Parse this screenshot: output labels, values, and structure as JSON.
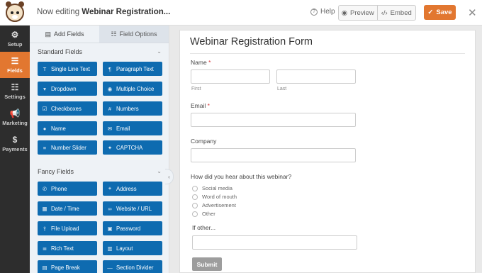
{
  "topbar": {
    "title_prefix": "Now editing ",
    "title_form": "Webinar Registration...",
    "help_label": "Help",
    "preview_label": "Preview",
    "embed_label": "Embed",
    "save_label": "Save",
    "close_glyph": "✕"
  },
  "leftnav": [
    {
      "label": "Setup",
      "icon": "gear-icon"
    },
    {
      "label": "Fields",
      "icon": "list-icon"
    },
    {
      "label": "Settings",
      "icon": "sliders-icon"
    },
    {
      "label": "Marketing",
      "icon": "megaphone-icon"
    },
    {
      "label": "Payments",
      "icon": "dollar-icon"
    }
  ],
  "panel": {
    "tab_add": "Add Fields",
    "tab_options": "Field Options",
    "standard_title": "Standard Fields",
    "standard": [
      "Single Line Text",
      "Paragraph Text",
      "Dropdown",
      "Multiple Choice",
      "Checkboxes",
      "Numbers",
      "Name",
      "Email",
      "Number Slider",
      "CAPTCHA"
    ],
    "fancy_title": "Fancy Fields",
    "fancy": [
      "Phone",
      "Address",
      "Date / Time",
      "Website / URL",
      "File Upload",
      "Password",
      "Rich Text",
      "Layout",
      "Page Break",
      "Section Divider"
    ]
  },
  "form": {
    "title": "Webinar Registration Form",
    "name_label": "Name",
    "required_mark": "*",
    "first_label": "First",
    "last_label": "Last",
    "email_label": "Email",
    "company_label": "Company",
    "question": "How did you hear about this webinar?",
    "options": [
      "Social media",
      "Word of mouth",
      "Advertisement",
      "Other"
    ],
    "other_label": "If other...",
    "submit_label": "Submit"
  },
  "colors": {
    "accent": "#e27730",
    "field_button": "#0e6bb0",
    "nav_bg": "#2d2d2d"
  }
}
